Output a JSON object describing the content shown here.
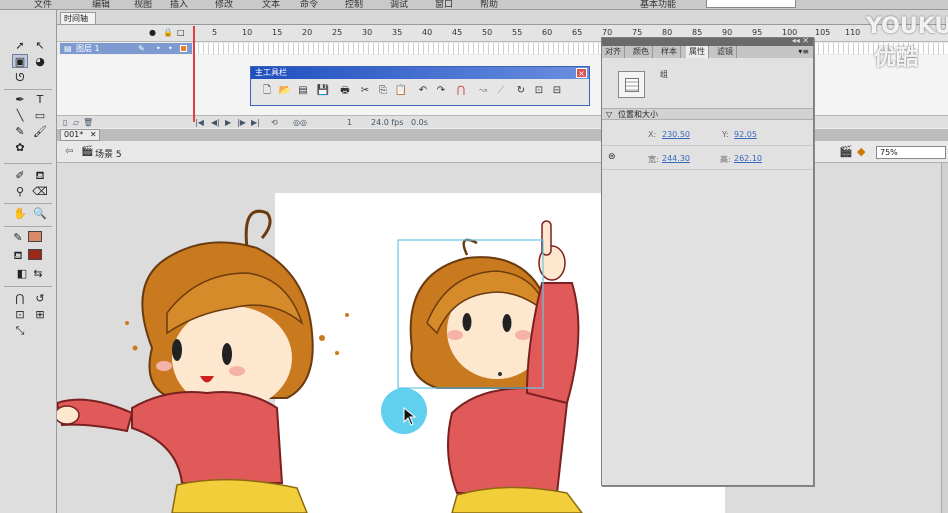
{
  "menubar": {
    "items": [
      "文件",
      "编辑",
      "视图",
      "插入",
      "修改",
      "文本",
      "命令",
      "控制",
      "调试",
      "窗口",
      "帮助"
    ],
    "workspace": "基本功能"
  },
  "timeline": {
    "tab_label": "时间轴",
    "layer_name": "图层 1",
    "frame_numbers": [
      "5",
      "10",
      "15",
      "20",
      "25",
      "30",
      "35",
      "40",
      "45",
      "50",
      "55",
      "60",
      "65",
      "70",
      "75",
      "80",
      "85",
      "90",
      "95",
      "100",
      "105",
      "110"
    ],
    "current_frame": "1",
    "fps": "24.0 fps",
    "elapsed": "0.0s"
  },
  "document": {
    "tab_label": "001*",
    "scene_label": "场景 5",
    "zoom": "75%"
  },
  "main_toolbar": {
    "title": "主工具栏",
    "close_label": "×"
  },
  "properties": {
    "tabs": [
      "对齐",
      "颜色",
      "样本",
      "属性",
      "滤镜"
    ],
    "active_tab": "属性",
    "instance_type": "组",
    "section_title": "位置和大小",
    "x_label": "X:",
    "x_value": "230.50",
    "y_label": "Y:",
    "y_value": "92.05",
    "w_label": "宽:",
    "w_value": "244.30",
    "h_label": "高:",
    "h_value": "262.10"
  },
  "watermark": {
    "brand": "YOUKU",
    "brand_cn": "优酷"
  },
  "colors": {
    "stroke_swatch": "#d98a6b",
    "fill_swatch": "#9b2a1c",
    "cursor_halo": "#4fcbec",
    "selection_box": "#69c6e6"
  }
}
